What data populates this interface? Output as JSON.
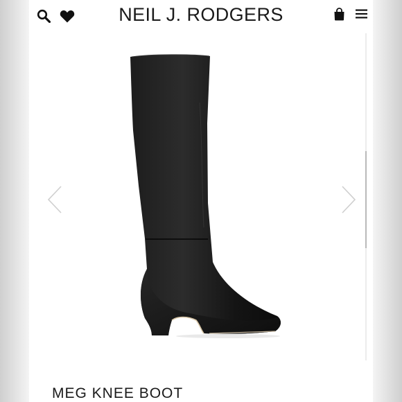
{
  "header": {
    "brand": "NEIL J. RODGERS",
    "icons": [
      "search-icon",
      "heart-icon",
      "shopping-bag-icon",
      "menu-icon"
    ]
  },
  "product": {
    "name": "MEG KNEE BOOT",
    "image": "black leather knee-high boot with flared heel"
  },
  "carousel": {
    "prev_icon": "chevron-left-icon",
    "next_icon": "chevron-right-icon"
  },
  "colors": {
    "brand_text": "#1a1a1a",
    "arrow": "#cfcfcf",
    "boot": "#141414"
  }
}
